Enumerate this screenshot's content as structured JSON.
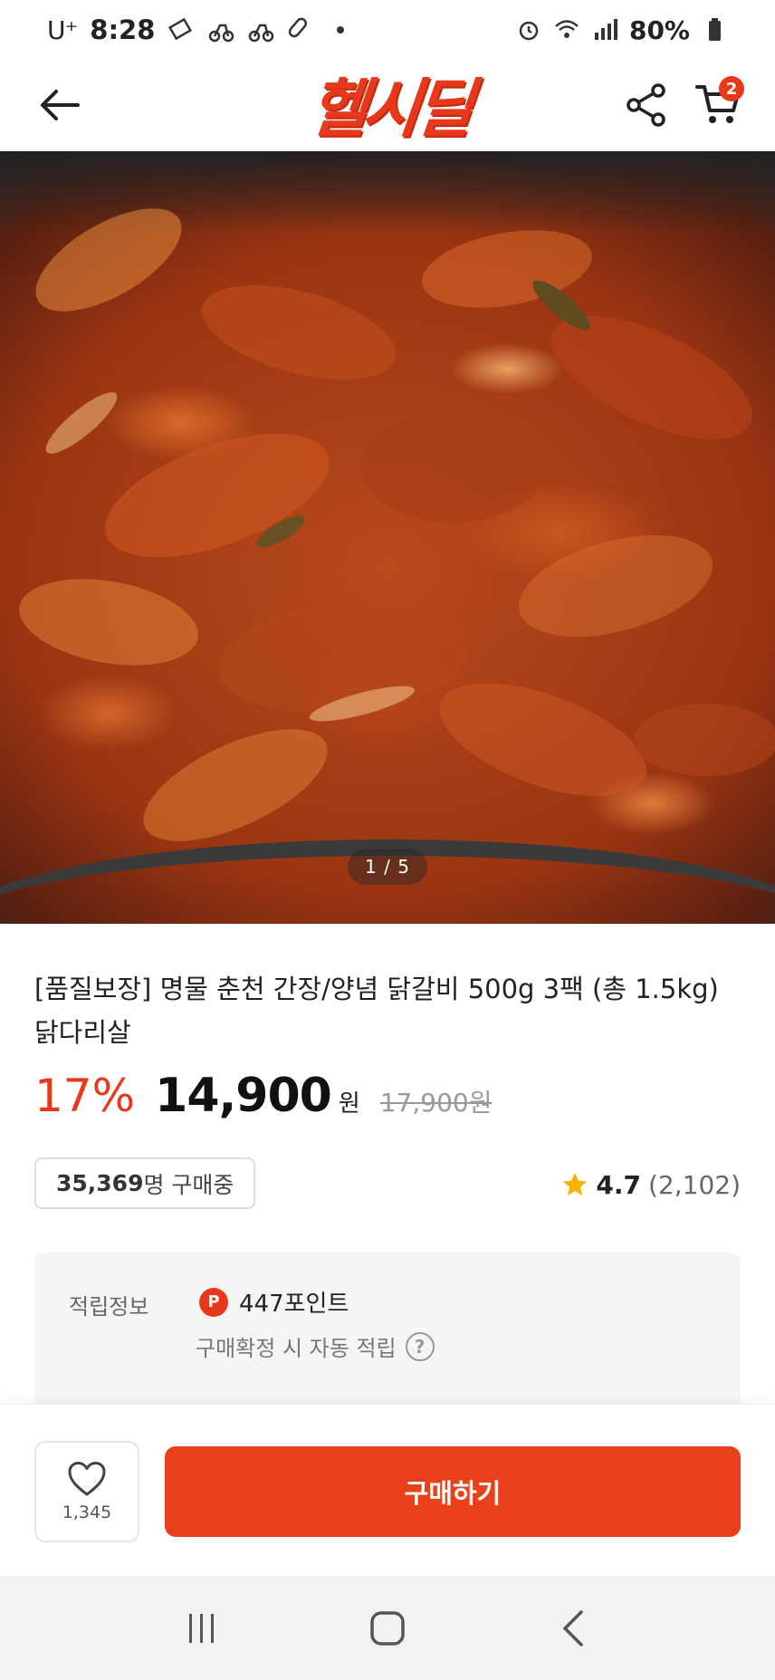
{
  "status_bar": {
    "carrier": "U⁺",
    "time": "8:28",
    "battery": "80%"
  },
  "header": {
    "logo": "헬시딜",
    "cart_count": "2"
  },
  "hero": {
    "counter": "1 / 5"
  },
  "product": {
    "title": "[품질보장] 명물 춘천 간장/양념 닭갈비 500g 3팩 (총 1.5kg) 닭다리살",
    "discount": "17%",
    "price": "14,900",
    "currency": "원",
    "original_price": "17,900원",
    "buyers_count": "35,369",
    "buyers_suffix": "명 구매중",
    "rating": "4.7",
    "review_count": "(2,102)"
  },
  "points": {
    "label": "적립정보",
    "icon_letter": "P",
    "amount": "447포인트",
    "note": "구매확정 시 자동 적립",
    "help": "?"
  },
  "bottom_bar": {
    "like_count": "1,345",
    "buy_label": "구매하기"
  },
  "colors": {
    "accent": "#e8381b",
    "buy_button": "#e8401b",
    "star": "#f5b400"
  },
  "icons": {
    "back": "back-arrow-icon",
    "share": "share-icon",
    "cart": "cart-icon",
    "star": "star-icon",
    "heart": "heart-icon",
    "nav_recent": "recent-apps-icon",
    "nav_home": "home-icon",
    "nav_back": "nav-back-icon"
  }
}
